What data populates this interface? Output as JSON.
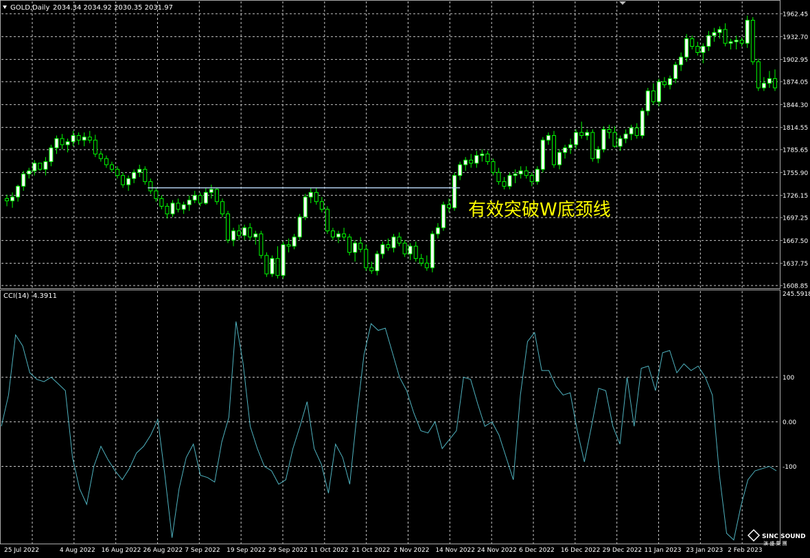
{
  "symbol_header": {
    "symbol": "GOLD,Daily",
    "ohlc": "2034.34 2034.92 2030.35 2031.97"
  },
  "indicator_header": {
    "name": "CCI(14)",
    "value": "4.3911"
  },
  "annotation": {
    "text": "有效突破W底颈线",
    "color": "#ffff00"
  },
  "watermark": {
    "text": "SINC SOUND",
    "sub": "演 盛 集 團"
  },
  "colors": {
    "background": "#000000",
    "grid": "#c8c8c8",
    "bull_candle": "#ffffff",
    "bear_candle": "#000000",
    "wick": "#00ff00",
    "cci_line": "#4fb3c0",
    "neckline": "#b4d2f0",
    "axis_text": "#ffffff"
  },
  "x_axis_labels": [
    "25 Jul 2022",
    "4 Aug 2022",
    "16 Aug 2022",
    "26 Aug 2022",
    "7 Sep 2022",
    "19 Sep 2022",
    "29 Sep 2022",
    "11 Oct 2022",
    "21 Oct 2022",
    "2 Nov 2022",
    "14 Nov 2022",
    "24 Nov 2022",
    "6 Dec 2022",
    "16 Dec 2022",
    "29 Dec 2022",
    "11 Jan 2023",
    "23 Jan 2023",
    "2 Feb 2023"
  ],
  "price_axis_labels": [
    "1962.45",
    "1932.70",
    "1902.95",
    "1874.05",
    "1844.30",
    "1814.55",
    "1785.65",
    "1755.90",
    "1726.15",
    "1697.25",
    "1667.50",
    "1637.75",
    "1608.85"
  ],
  "cci_axis_labels": [
    "245.5918",
    "100",
    "0.00",
    "-100"
  ],
  "chart_data": [
    {
      "type": "candlestick",
      "name": "GOLD,Daily",
      "ylim": [
        1608.85,
        1962.45
      ],
      "neckline": {
        "price": 1736,
        "from_index": 26,
        "to_index": 82
      },
      "ohlc": [
        [
          1722,
          1727,
          1712,
          1719
        ],
        [
          1719,
          1730,
          1710,
          1724
        ],
        [
          1724,
          1740,
          1718,
          1738
        ],
        [
          1738,
          1758,
          1732,
          1754
        ],
        [
          1754,
          1762,
          1748,
          1758
        ],
        [
          1758,
          1772,
          1752,
          1768
        ],
        [
          1768,
          1766,
          1758,
          1760
        ],
        [
          1760,
          1776,
          1752,
          1770
        ],
        [
          1770,
          1792,
          1764,
          1788
        ],
        [
          1788,
          1804,
          1780,
          1800
        ],
        [
          1800,
          1806,
          1786,
          1792
        ],
        [
          1792,
          1800,
          1782,
          1796
        ],
        [
          1796,
          1810,
          1790,
          1804
        ],
        [
          1804,
          1808,
          1792,
          1798
        ],
        [
          1798,
          1808,
          1790,
          1802
        ],
        [
          1802,
          1810,
          1794,
          1798
        ],
        [
          1798,
          1805,
          1776,
          1780
        ],
        [
          1780,
          1784,
          1770,
          1774
        ],
        [
          1774,
          1778,
          1762,
          1766
        ],
        [
          1766,
          1770,
          1756,
          1760
        ],
        [
          1760,
          1764,
          1748,
          1752
        ],
        [
          1752,
          1756,
          1736,
          1740
        ],
        [
          1740,
          1752,
          1732,
          1748
        ],
        [
          1748,
          1760,
          1742,
          1756
        ],
        [
          1756,
          1766,
          1750,
          1760
        ],
        [
          1760,
          1764,
          1740,
          1744
        ],
        [
          1744,
          1748,
          1728,
          1732
        ],
        [
          1732,
          1736,
          1718,
          1722
        ],
        [
          1722,
          1726,
          1708,
          1712
        ],
        [
          1712,
          1716,
          1696,
          1702
        ],
        [
          1702,
          1720,
          1698,
          1716
        ],
        [
          1716,
          1722,
          1704,
          1708
        ],
        [
          1708,
          1718,
          1702,
          1714
        ],
        [
          1714,
          1726,
          1706,
          1720
        ],
        [
          1720,
          1732,
          1716,
          1726
        ],
        [
          1726,
          1730,
          1712,
          1716
        ],
        [
          1716,
          1736,
          1714,
          1730
        ],
        [
          1730,
          1740,
          1722,
          1734
        ],
        [
          1734,
          1736,
          1714,
          1718
        ],
        [
          1718,
          1722,
          1698,
          1702
        ],
        [
          1702,
          1706,
          1664,
          1668
        ],
        [
          1668,
          1684,
          1660,
          1680
        ],
        [
          1680,
          1688,
          1668,
          1674
        ],
        [
          1674,
          1688,
          1668,
          1684
        ],
        [
          1684,
          1690,
          1668,
          1672
        ],
        [
          1672,
          1680,
          1662,
          1676
        ],
        [
          1676,
          1680,
          1644,
          1648
        ],
        [
          1648,
          1652,
          1620,
          1624
        ],
        [
          1624,
          1648,
          1620,
          1644
        ],
        [
          1644,
          1660,
          1618,
          1622
        ],
        [
          1622,
          1666,
          1618,
          1662
        ],
        [
          1662,
          1670,
          1652,
          1660
        ],
        [
          1660,
          1676,
          1656,
          1672
        ],
        [
          1672,
          1702,
          1668,
          1698
        ],
        [
          1698,
          1728,
          1694,
          1724
        ],
        [
          1724,
          1736,
          1716,
          1730
        ],
        [
          1730,
          1736,
          1714,
          1718
        ],
        [
          1718,
          1724,
          1704,
          1708
        ],
        [
          1708,
          1712,
          1676,
          1680
        ],
        [
          1680,
          1684,
          1668,
          1672
        ],
        [
          1672,
          1680,
          1664,
          1676
        ],
        [
          1676,
          1684,
          1668,
          1672
        ],
        [
          1672,
          1676,
          1648,
          1652
        ],
        [
          1652,
          1668,
          1640,
          1664
        ],
        [
          1664,
          1672,
          1652,
          1656
        ],
        [
          1656,
          1662,
          1628,
          1632
        ],
        [
          1632,
          1640,
          1624,
          1628
        ],
        [
          1628,
          1654,
          1622,
          1650
        ],
        [
          1650,
          1666,
          1644,
          1662
        ],
        [
          1662,
          1670,
          1654,
          1658
        ],
        [
          1658,
          1676,
          1652,
          1672
        ],
        [
          1672,
          1678,
          1660,
          1664
        ],
        [
          1664,
          1668,
          1646,
          1650
        ],
        [
          1650,
          1664,
          1642,
          1660
        ],
        [
          1660,
          1666,
          1640,
          1644
        ],
        [
          1644,
          1650,
          1634,
          1638
        ],
        [
          1638,
          1648,
          1628,
          1632
        ],
        [
          1632,
          1680,
          1626,
          1676
        ],
        [
          1676,
          1690,
          1670,
          1684
        ],
        [
          1684,
          1718,
          1680,
          1714
        ],
        [
          1714,
          1722,
          1704,
          1710
        ],
        [
          1710,
          1756,
          1706,
          1752
        ],
        [
          1752,
          1770,
          1746,
          1766
        ],
        [
          1766,
          1776,
          1758,
          1772
        ],
        [
          1772,
          1780,
          1762,
          1768
        ],
        [
          1768,
          1784,
          1762,
          1778
        ],
        [
          1778,
          1786,
          1770,
          1780
        ],
        [
          1780,
          1784,
          1766,
          1770
        ],
        [
          1770,
          1774,
          1752,
          1756
        ],
        [
          1756,
          1762,
          1740,
          1744
        ],
        [
          1744,
          1750,
          1734,
          1738
        ],
        [
          1738,
          1756,
          1734,
          1752
        ],
        [
          1752,
          1760,
          1742,
          1754
        ],
        [
          1754,
          1764,
          1748,
          1758
        ],
        [
          1758,
          1764,
          1748,
          1752
        ],
        [
          1752,
          1756,
          1738,
          1744
        ],
        [
          1744,
          1764,
          1740,
          1760
        ],
        [
          1760,
          1802,
          1756,
          1798
        ],
        [
          1798,
          1808,
          1792,
          1804
        ],
        [
          1804,
          1810,
          1762,
          1766
        ],
        [
          1766,
          1786,
          1760,
          1782
        ],
        [
          1782,
          1792,
          1774,
          1788
        ],
        [
          1788,
          1800,
          1780,
          1792
        ],
        [
          1792,
          1812,
          1786,
          1808
        ],
        [
          1808,
          1822,
          1800,
          1804
        ],
        [
          1804,
          1812,
          1798,
          1808
        ],
        [
          1808,
          1812,
          1770,
          1774
        ],
        [
          1774,
          1790,
          1768,
          1786
        ],
        [
          1786,
          1816,
          1782,
          1812
        ],
        [
          1812,
          1818,
          1800,
          1808
        ],
        [
          1808,
          1816,
          1788,
          1790
        ],
        [
          1790,
          1804,
          1784,
          1800
        ],
        [
          1800,
          1812,
          1794,
          1806
        ],
        [
          1806,
          1818,
          1798,
          1814
        ],
        [
          1814,
          1820,
          1800,
          1804
        ],
        [
          1804,
          1840,
          1800,
          1836
        ],
        [
          1836,
          1866,
          1830,
          1862
        ],
        [
          1862,
          1872,
          1844,
          1848
        ],
        [
          1848,
          1878,
          1842,
          1874
        ],
        [
          1874,
          1880,
          1866,
          1870
        ],
        [
          1870,
          1882,
          1864,
          1878
        ],
        [
          1878,
          1900,
          1872,
          1896
        ],
        [
          1896,
          1912,
          1888,
          1906
        ],
        [
          1906,
          1936,
          1900,
          1930
        ],
        [
          1930,
          1934,
          1916,
          1920
        ],
        [
          1920,
          1926,
          1908,
          1912
        ],
        [
          1912,
          1924,
          1898,
          1920
        ],
        [
          1920,
          1940,
          1914,
          1934
        ],
        [
          1934,
          1944,
          1926,
          1938
        ],
        [
          1938,
          1946,
          1930,
          1942
        ],
        [
          1942,
          1950,
          1920,
          1924
        ],
        [
          1924,
          1930,
          1916,
          1926
        ],
        [
          1926,
          1934,
          1916,
          1928
        ],
        [
          1928,
          1932,
          1920,
          1924
        ],
        [
          1924,
          1960,
          1918,
          1954
        ],
        [
          1954,
          1958,
          1896,
          1900
        ],
        [
          1900,
          1904,
          1862,
          1866
        ],
        [
          1866,
          1880,
          1862,
          1872
        ],
        [
          1872,
          1888,
          1866,
          1878
        ],
        [
          1878,
          1890,
          1862,
          1866
        ]
      ]
    },
    {
      "type": "line",
      "name": "CCI(14)",
      "ylim": [
        -270,
        245.5918
      ],
      "values": [
        -10,
        60,
        195,
        170,
        110,
        95,
        90,
        100,
        85,
        70,
        -80,
        -150,
        -185,
        -100,
        -55,
        -85,
        -110,
        -130,
        -105,
        -70,
        -55,
        -30,
        5,
        -120,
        -260,
        -150,
        -80,
        -50,
        -120,
        -125,
        -135,
        -45,
        10,
        225,
        130,
        -10,
        -60,
        -100,
        -110,
        -140,
        -130,
        -60,
        -10,
        45,
        -60,
        -95,
        -160,
        -50,
        -80,
        -140,
        15,
        150,
        220,
        205,
        210,
        155,
        100,
        70,
        20,
        -20,
        -25,
        0,
        -60,
        -40,
        -20,
        100,
        95,
        40,
        -10,
        0,
        -30,
        -80,
        -130,
        60,
        180,
        200,
        115,
        115,
        80,
        60,
        65,
        -20,
        -90,
        -10,
        75,
        70,
        -10,
        -50,
        100,
        -10,
        120,
        125,
        70,
        155,
        160,
        110,
        130,
        115,
        125,
        100,
        60,
        -120,
        -250,
        -265,
        -190,
        -130,
        -110,
        -105,
        -100,
        -110
      ]
    }
  ]
}
